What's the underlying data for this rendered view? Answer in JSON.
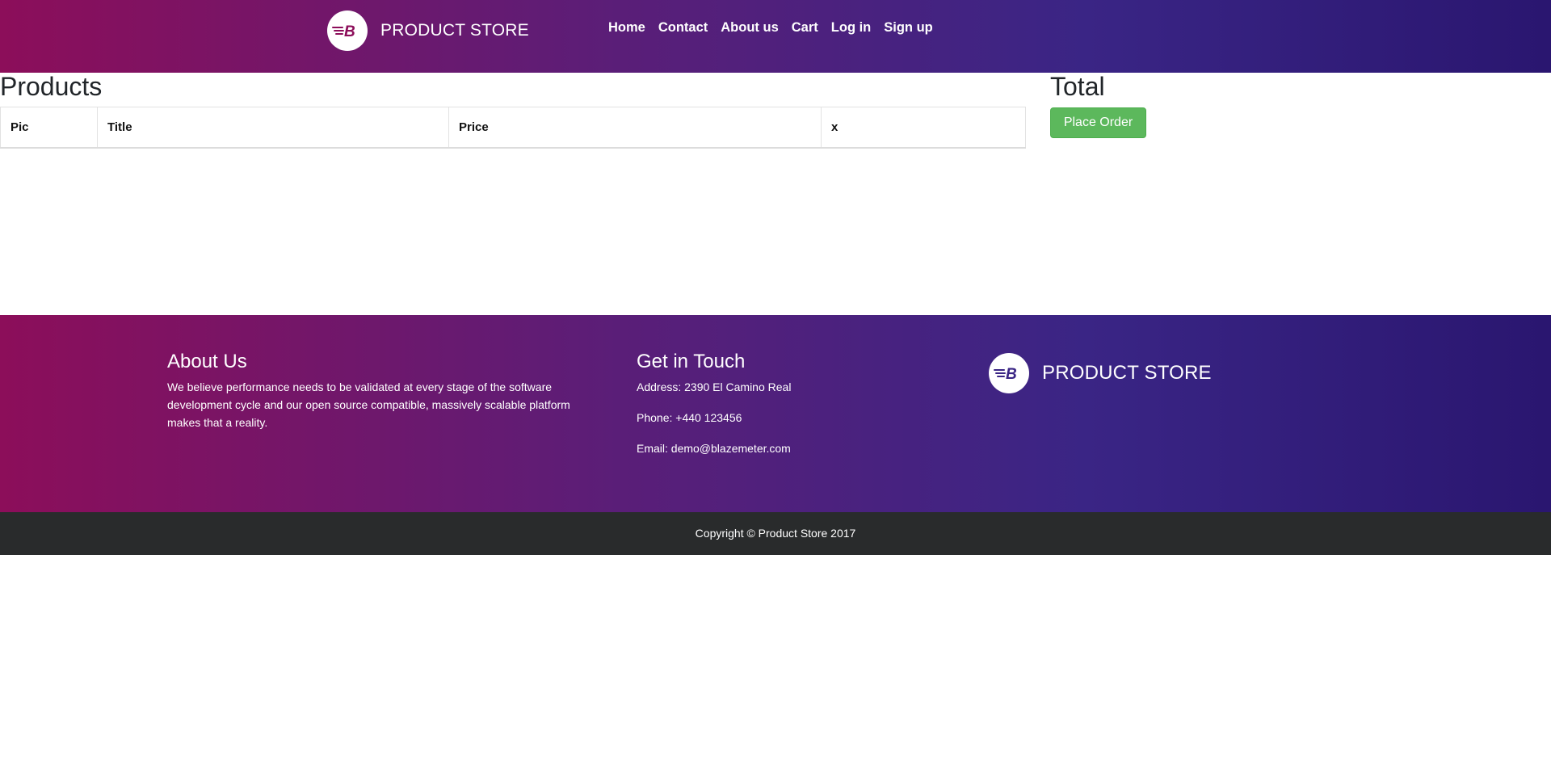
{
  "header": {
    "brand": "PRODUCT STORE",
    "logo_letter": "B",
    "nav": [
      "Home",
      "Contact",
      "About us",
      "Cart",
      "Log in",
      "Sign up"
    ]
  },
  "cart": {
    "products_title": "Products",
    "columns": [
      "Pic",
      "Title",
      "Price",
      "x"
    ],
    "total_title": "Total",
    "place_order_label": "Place Order"
  },
  "footer": {
    "about_title": "About Us",
    "about_text": "We believe performance needs to be validated at every stage of the software development cycle and our open source compatible, massively scalable platform makes that a reality.",
    "contact_title": "Get in Touch",
    "address": "Address: 2390 El Camino Real",
    "phone": "Phone: +440 123456",
    "email": "Email: demo@blazemeter.com",
    "brand": "PRODUCT STORE",
    "logo_letter": "B",
    "copyright": "Copyright © Product Store 2017"
  },
  "colors": {
    "gradient_start": "#8c0e5a",
    "gradient_end": "#2a1670",
    "place_order_bg": "#5cb85c",
    "copyright_bg": "#292b2c"
  },
  "icons": [
    "blazemeter-logo-icon"
  ]
}
